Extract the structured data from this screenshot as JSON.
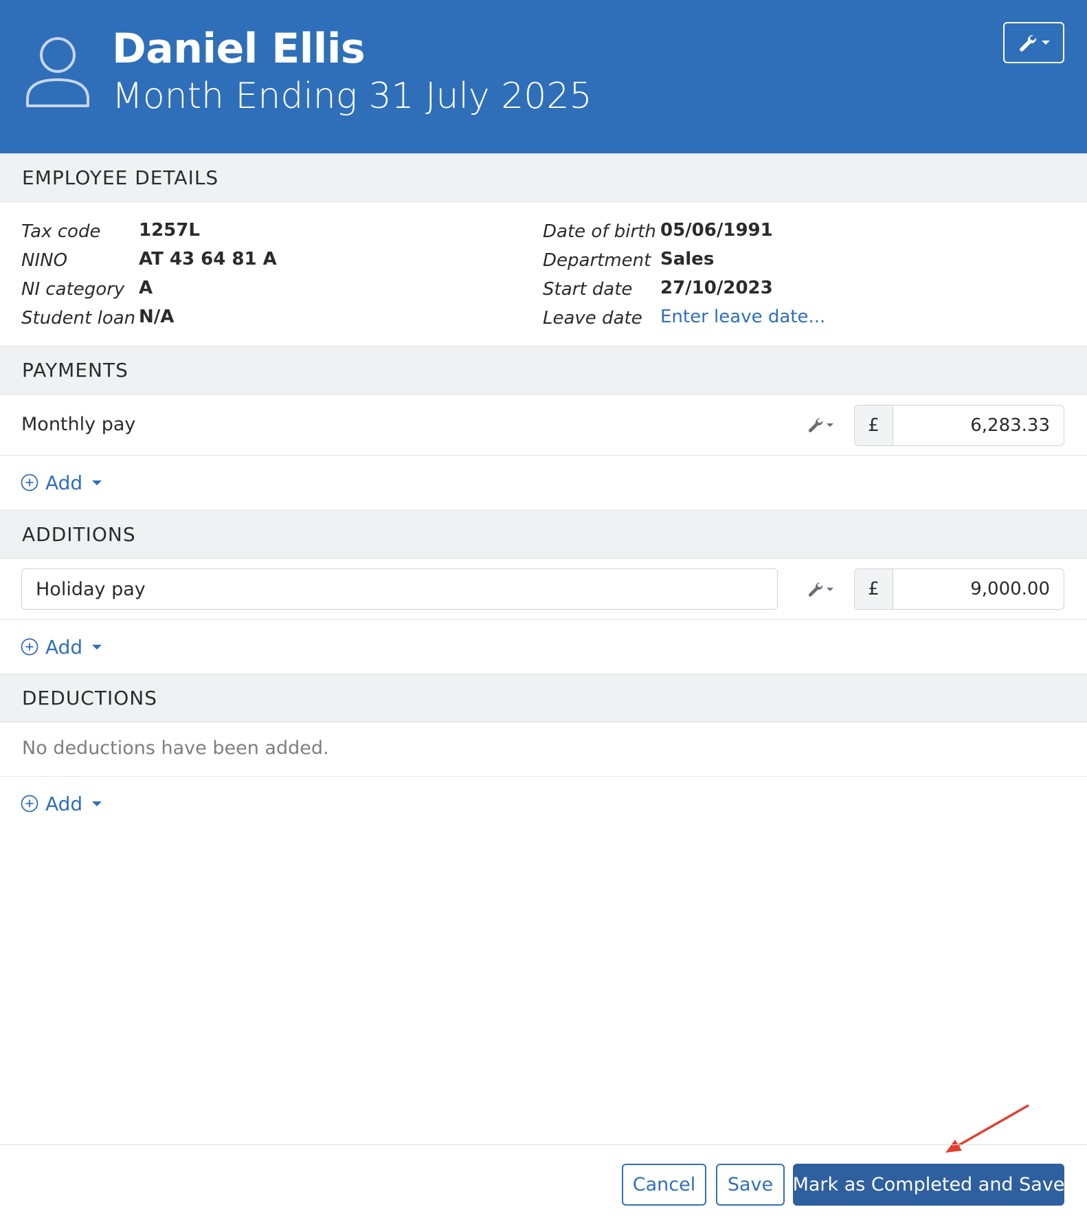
{
  "header": {
    "employee_name": "Daniel Ellis",
    "period": "Month Ending 31 July 2025",
    "bg_color": "#2f6fba"
  },
  "employee_details": {
    "heading": "EMPLOYEE DETAILS",
    "left": [
      {
        "label": "Tax code",
        "value": "1257L"
      },
      {
        "label": "NINO",
        "value": "AT 43 64 81 A"
      },
      {
        "label": "NI category",
        "value": "A"
      },
      {
        "label": "Student loan",
        "value": "N/A"
      }
    ],
    "right": [
      {
        "label": "Date of birth",
        "value": "05/06/1991"
      },
      {
        "label": "Department",
        "value": "Sales"
      },
      {
        "label": "Start date",
        "value": "27/10/2023"
      },
      {
        "label": "Leave date",
        "value": "Enter leave date..."
      }
    ]
  },
  "payments": {
    "heading": "PAYMENTS",
    "rows": [
      {
        "label": "Monthly pay",
        "currency": "£",
        "amount": "6,283.33"
      }
    ],
    "add_label": "Add"
  },
  "additions": {
    "heading": "ADDITIONS",
    "rows": [
      {
        "label": "Holiday pay",
        "currency": "£",
        "amount": "9,000.00"
      }
    ],
    "add_label": "Add"
  },
  "deductions": {
    "heading": "DEDUCTIONS",
    "empty_message": "No deductions have been added.",
    "add_label": "Add"
  },
  "footer": {
    "cancel_label": "Cancel",
    "save_label": "Save",
    "complete_label": "Mark as Completed and Save",
    "primary_color": "#2e5f9e"
  },
  "annotation": {
    "arrow_color": "#e0412f"
  }
}
